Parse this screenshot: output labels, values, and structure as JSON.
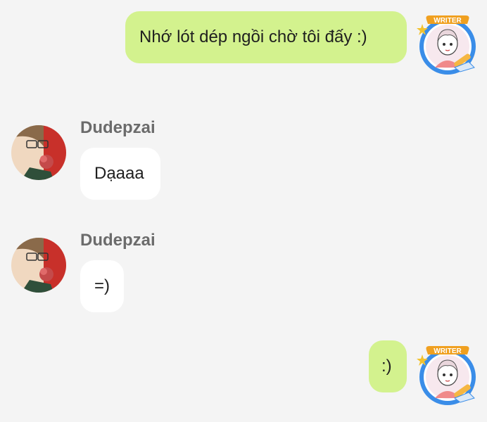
{
  "messages": [
    {
      "id": 1,
      "direction": "outgoing",
      "text": "Nhớ lót dép ngồi chờ tôi đấy :)",
      "avatar": "writer-avatar",
      "badge": "WRITER"
    },
    {
      "id": 2,
      "direction": "incoming",
      "sender": "Dudepzai",
      "text": "Dạaaa",
      "avatar": "dudepzai-avatar"
    },
    {
      "id": 3,
      "direction": "incoming",
      "sender": "Dudepzai",
      "text": "=)",
      "avatar": "dudepzai-avatar"
    },
    {
      "id": 4,
      "direction": "outgoing",
      "text": ":)",
      "avatar": "writer-avatar",
      "badge": "WRITER"
    }
  ],
  "colors": {
    "background": "#f4f4f4",
    "outgoing_bubble": "#d3f28e",
    "incoming_bubble": "#ffffff",
    "sender_name": "#6b6b6b",
    "badge_ring": "#3a8de8",
    "badge_label": "#f0a020"
  }
}
